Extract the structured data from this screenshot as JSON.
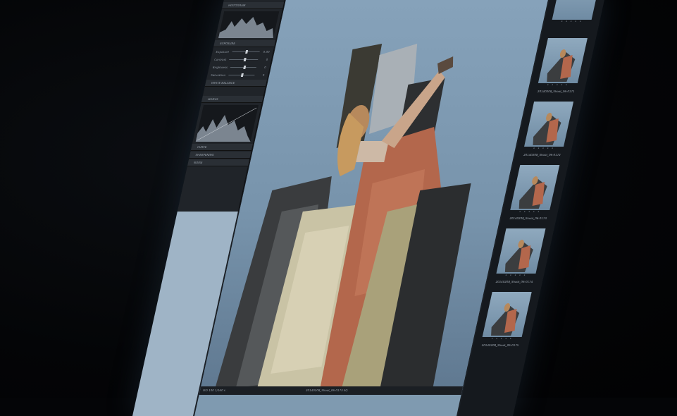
{
  "app": {
    "left_panel": {
      "sections": [
        "HISTOGRAM",
        "EXPOSURE",
        "WHITE BALANCE",
        "LEVELS",
        "CURVE",
        "SHARPENING",
        "NOISE"
      ],
      "sliders": [
        {
          "label": "Exposure",
          "value": "0.00"
        },
        {
          "label": "Contrast",
          "value": "0"
        },
        {
          "label": "Brightness",
          "value": "0"
        },
        {
          "label": "Saturation",
          "value": "0"
        }
      ],
      "histogram_value": "2.0"
    },
    "viewer": {
      "status_left": "ISO 100   1/160 s",
      "status_center": "20140208_Shoot_06-0173.IIQ",
      "accent_color": "#c67a2a"
    },
    "filmstrip": {
      "thumbs": [
        {
          "caption": ""
        },
        {
          "caption": "20140208_Shoot_06-0171"
        },
        {
          "caption": "20140208_Shoot_06-0172"
        },
        {
          "caption": "20140208_Shoot_06-0173"
        },
        {
          "caption": "20140208_Shoot_06-0174"
        },
        {
          "caption": "20140208_Shoot_06-0175"
        }
      ]
    }
  }
}
